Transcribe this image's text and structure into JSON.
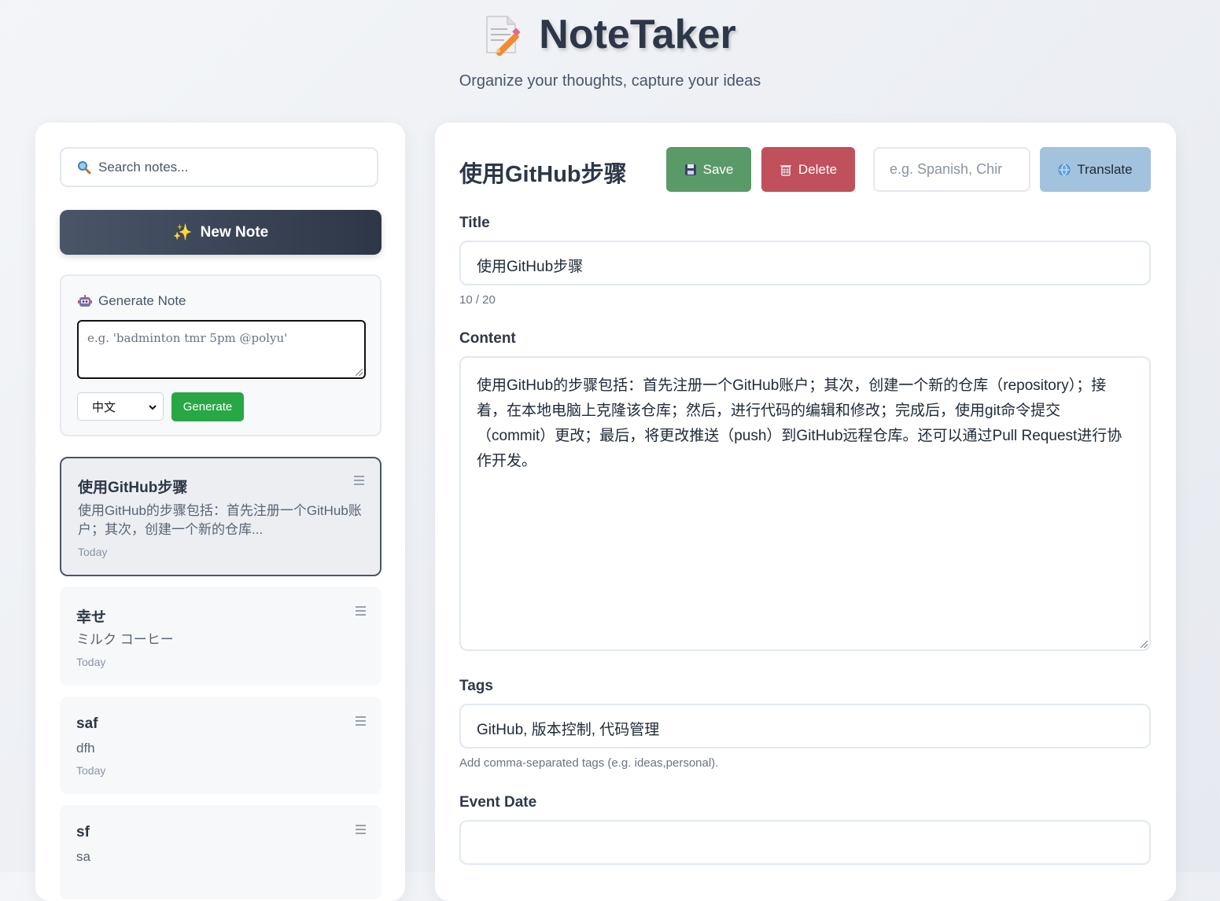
{
  "app": {
    "title": "NoteTaker",
    "subtitle": "Organize your thoughts, capture your ideas"
  },
  "sidebar": {
    "search_placeholder": "Search notes...",
    "new_note_label": "New Note",
    "generate": {
      "title": "Generate Note",
      "placeholder": "e.g. 'badminton tmr 5pm @polyu'",
      "language": "中文",
      "button_label": "Generate"
    },
    "notes": [
      {
        "title": "使用GitHub步骤",
        "preview": "使用GitHub的步骤包括：首先注册一个GitHub账户；其次，创建一个新的仓库...",
        "date": "Today",
        "active": true
      },
      {
        "title": "幸せ",
        "preview": "ミルク コーヒー",
        "date": "Today",
        "active": false
      },
      {
        "title": "saf",
        "preview": "dfh",
        "date": "Today",
        "active": false
      },
      {
        "title": "sf",
        "preview": "sa",
        "date": "",
        "active": false
      }
    ]
  },
  "editor": {
    "heading": "使用GitHub步骤",
    "save_label": "Save",
    "delete_label": "Delete",
    "translate_placeholder": "e.g. Spanish, Chir",
    "translate_label": "Translate",
    "title_label": "Title",
    "title_value": "使用GitHub步骤",
    "title_counter": "10 / 20",
    "content_label": "Content",
    "content_value": "使用GitHub的步骤包括：首先注册一个GitHub账户；其次，创建一个新的仓库（repository）；接着，在本地电脑上克隆该仓库；然后，进行代码的编辑和修改；完成后，使用git命令提交（commit）更改；最后，将更改推送（push）到GitHub远程仓库。还可以通过Pull Request进行协作开发。",
    "tags_label": "Tags",
    "tags_value": "GitHub, 版本控制, 代码管理",
    "tags_help": "Add comma-separated tags (e.g. ideas,personal).",
    "event_date_label": "Event Date",
    "event_date_value": ""
  },
  "colors": {
    "accent_dark": "#2d3748",
    "save": "#5a9a68",
    "delete": "#c0505c",
    "translate": "#a3c2de",
    "generate": "#28a745"
  }
}
